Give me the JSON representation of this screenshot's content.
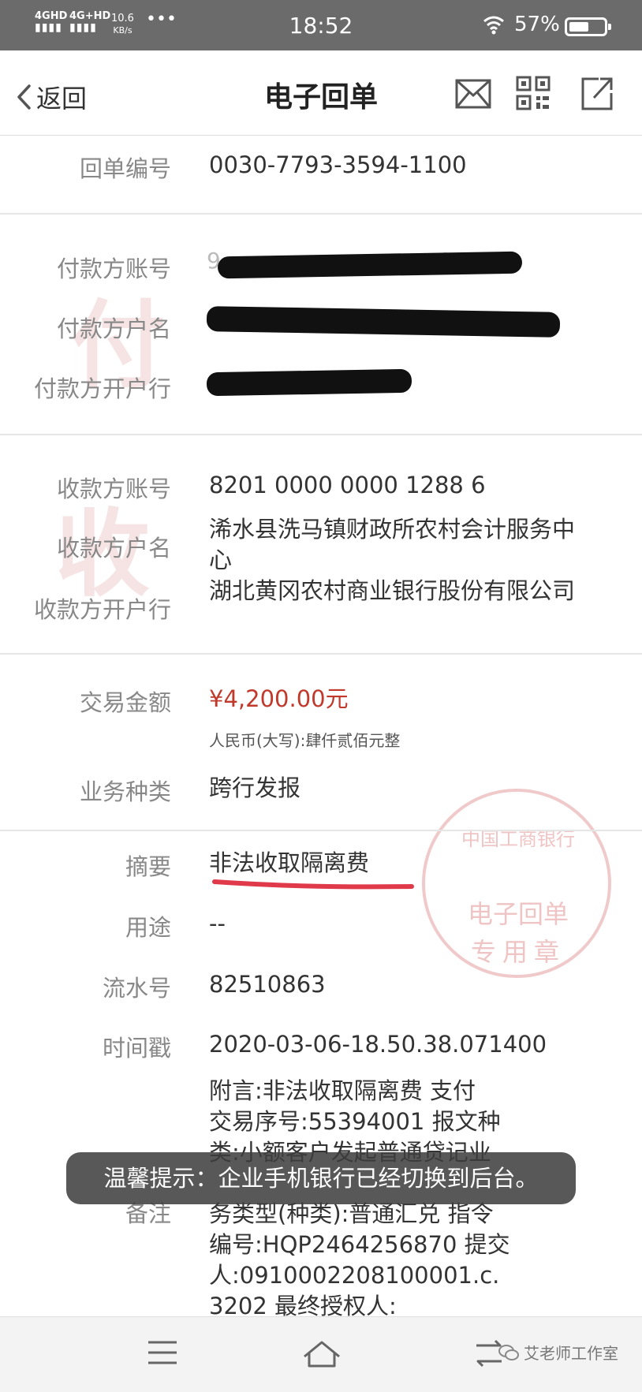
{
  "status_bar": {
    "signal_1": "4GHD",
    "signal_2": "4G+HD",
    "speed_value": "10.6",
    "speed_unit": "KB/s",
    "dots": "•••",
    "time": "18:52",
    "battery": "57%",
    "battery_level": 0.57
  },
  "nav": {
    "back_label": "返回",
    "title": "电子回单",
    "icons": [
      "mail-icon",
      "qr-code-icon",
      "share-icon"
    ]
  },
  "receipt": {
    "number_label": "回单编号",
    "number_value": "0030-7793-3594-1100",
    "payer_account_label": "付款方账号",
    "payer_name_label": "付款方户名",
    "payer_bank_label": "付款方开户行",
    "payee_account_label": "收款方账号",
    "payee_account_value": "8201 0000 0000 1288 6",
    "payee_name_label": "收款方户名",
    "payee_name_value": "浠水县洗马镇财政所农村会计服务中心",
    "payee_bank_label": "收款方开户行",
    "payee_bank_value": "湖北黄冈农村商业银行股份有限公司",
    "amount_label": "交易金额",
    "amount_value": "¥4,200.00元",
    "amount_upper": "人民币(大写):肆仟贰佰元整",
    "business_type_label": "业务种类",
    "business_type_value": "跨行发报",
    "summary_label": "摘要",
    "summary_value": "非法收取隔离费",
    "purpose_label": "用途",
    "purpose_value": "--",
    "serial_label": "流水号",
    "serial_value": "82510863",
    "timestamp_label": "时间戳",
    "timestamp_value": "2020-03-06-18.50.38.071400",
    "remark_label": "备注",
    "remark_lines": [
      "附言:非法收取隔离费 支付",
      "交易序号:55394001 报文种",
      "类:小额客户发起普通贷记业",
      "",
      "务类型(种类):普通汇兑 指令",
      "编号:HQP2464256870 提交",
      "人:0910002208100001.c.",
      "3202 最终授权人:"
    ]
  },
  "watermarks": {
    "payer_char": "付",
    "payee_char": "收"
  },
  "stamp": {
    "ring_text": "中国工商银行",
    "line1": "电子回单",
    "line2": "专用章"
  },
  "toast": {
    "text": "温馨提示：企业手机银行已经切换到后台。"
  },
  "bottom": {
    "wechat_label": "艾老师工作室"
  },
  "colors": {
    "amount_red": "#c0392b",
    "status_bar_bg": "#6b6b6b",
    "underline_red": "#e03a4a"
  }
}
